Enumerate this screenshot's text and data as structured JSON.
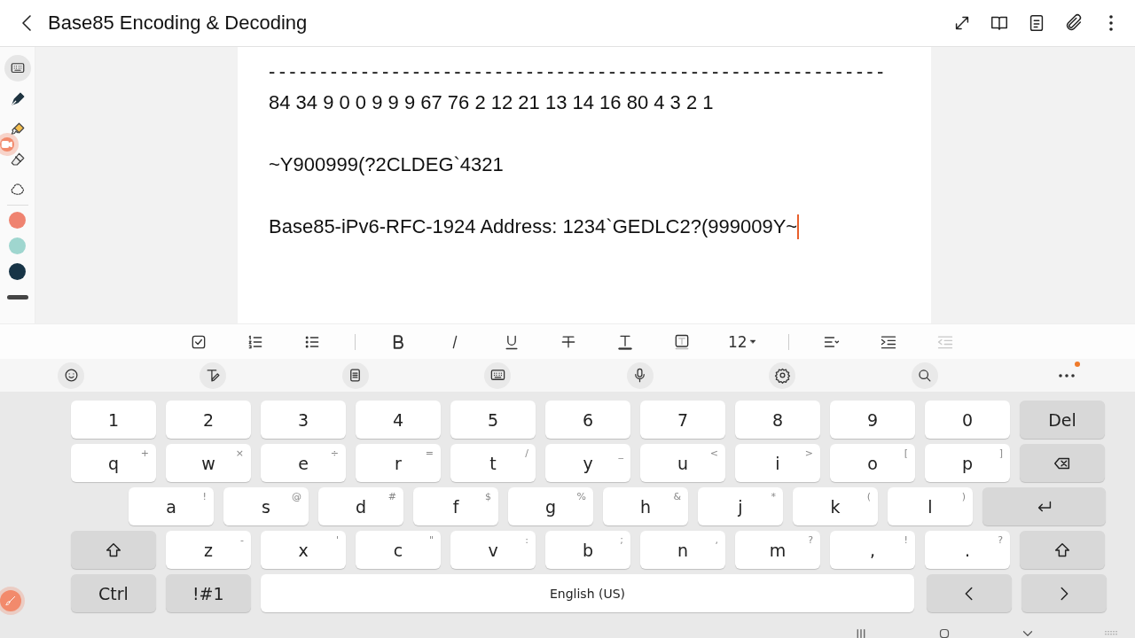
{
  "window": {
    "title": "Base85 Encoding & Decoding"
  },
  "header_actions": [
    {
      "kind": "expand"
    },
    {
      "kind": "book"
    },
    {
      "kind": "list"
    },
    {
      "kind": "attach"
    },
    {
      "kind": "more"
    }
  ],
  "tools": [
    {
      "kind": "keyboard",
      "selected": true
    },
    {
      "kind": "pen",
      "selected": false
    },
    {
      "kind": "highlighter",
      "selected": false
    },
    {
      "kind": "eraser",
      "selected": false
    },
    {
      "kind": "lasso",
      "selected": false
    }
  ],
  "pen_colors": [
    {
      "color": "#ef8370"
    },
    {
      "color": "#9fd6cf"
    },
    {
      "color": "#173446"
    }
  ],
  "document": {
    "lines": [
      "------------------------------------------------------------",
      "84 34 9 0 0 9 9 9 67 76 2 12 21 13 14 16 80 4 3 2 1",
      "~Y900999(?2CLDEG`4321",
      "Base85-iPv6-RFC-1924 Address: 1234`GEDLC2?(999009Y~"
    ]
  },
  "format_bar": [
    {
      "kind": "checkbox"
    },
    {
      "kind": "numbered-list"
    },
    {
      "kind": "bullet-list"
    },
    {
      "kind": "divider"
    },
    {
      "kind": "bold"
    },
    {
      "kind": "italic"
    },
    {
      "kind": "underline"
    },
    {
      "kind": "strike"
    },
    {
      "kind": "text-color"
    },
    {
      "kind": "text-bg"
    },
    {
      "kind": "size",
      "label": "12"
    },
    {
      "kind": "divider"
    },
    {
      "kind": "align"
    },
    {
      "kind": "indent"
    },
    {
      "kind": "outdent",
      "disabled": true
    }
  ],
  "keyboard_toolbar": [
    {
      "kind": "emoji"
    },
    {
      "kind": "handwriting"
    },
    {
      "kind": "clipboard"
    },
    {
      "kind": "keyboard"
    },
    {
      "kind": "mic"
    },
    {
      "kind": "settings"
    },
    {
      "kind": "search"
    },
    {
      "kind": "more",
      "badge": true
    }
  ],
  "keyboard": {
    "rows": [
      {
        "keys": [
          {
            "label": "1"
          },
          {
            "label": "2"
          },
          {
            "label": "3"
          },
          {
            "label": "4"
          },
          {
            "label": "5"
          },
          {
            "label": "6"
          },
          {
            "label": "7"
          },
          {
            "label": "8"
          },
          {
            "label": "9"
          },
          {
            "label": "0"
          },
          {
            "label": "Del",
            "kind": "special"
          }
        ]
      },
      {
        "keys": [
          {
            "label": "q",
            "hint": "+"
          },
          {
            "label": "w",
            "hint": "×"
          },
          {
            "label": "e",
            "hint": "÷"
          },
          {
            "label": "r",
            "hint": "="
          },
          {
            "label": "t",
            "hint": "/"
          },
          {
            "label": "y",
            "hint": "_"
          },
          {
            "label": "u",
            "hint": "<"
          },
          {
            "label": "i",
            "hint": ">"
          },
          {
            "label": "o",
            "hint": "["
          },
          {
            "label": "p",
            "hint": "]"
          },
          {
            "kind": "backspace"
          }
        ]
      },
      {
        "keys": [
          {
            "label": "a",
            "hint": "!"
          },
          {
            "label": "s",
            "hint": "@"
          },
          {
            "label": "d",
            "hint": "#"
          },
          {
            "label": "f",
            "hint": "$"
          },
          {
            "label": "g",
            "hint": "%"
          },
          {
            "label": "h",
            "hint": "&"
          },
          {
            "label": "j",
            "hint": "*"
          },
          {
            "label": "k",
            "hint": "("
          },
          {
            "label": "l",
            "hint": ")"
          },
          {
            "kind": "enter"
          }
        ]
      },
      {
        "keys": [
          {
            "kind": "shift"
          },
          {
            "label": "z",
            "hint": "-"
          },
          {
            "label": "x",
            "hint": "'"
          },
          {
            "label": "c",
            "hint": "\""
          },
          {
            "label": "v",
            "hint": ":"
          },
          {
            "label": "b",
            "hint": ";"
          },
          {
            "label": "n",
            "hint": ","
          },
          {
            "label": "m",
            "hint": "?"
          },
          {
            "label": ",",
            "hint": "!"
          },
          {
            "label": ".",
            "hint": "?"
          },
          {
            "kind": "shift"
          }
        ]
      },
      {
        "keys": [
          {
            "label": "Ctrl",
            "kind": "special"
          },
          {
            "label": "!#1",
            "kind": "special"
          },
          {
            "label": "English (US)",
            "kind": "space"
          },
          {
            "kind": "left"
          },
          {
            "kind": "right"
          }
        ]
      }
    ]
  }
}
